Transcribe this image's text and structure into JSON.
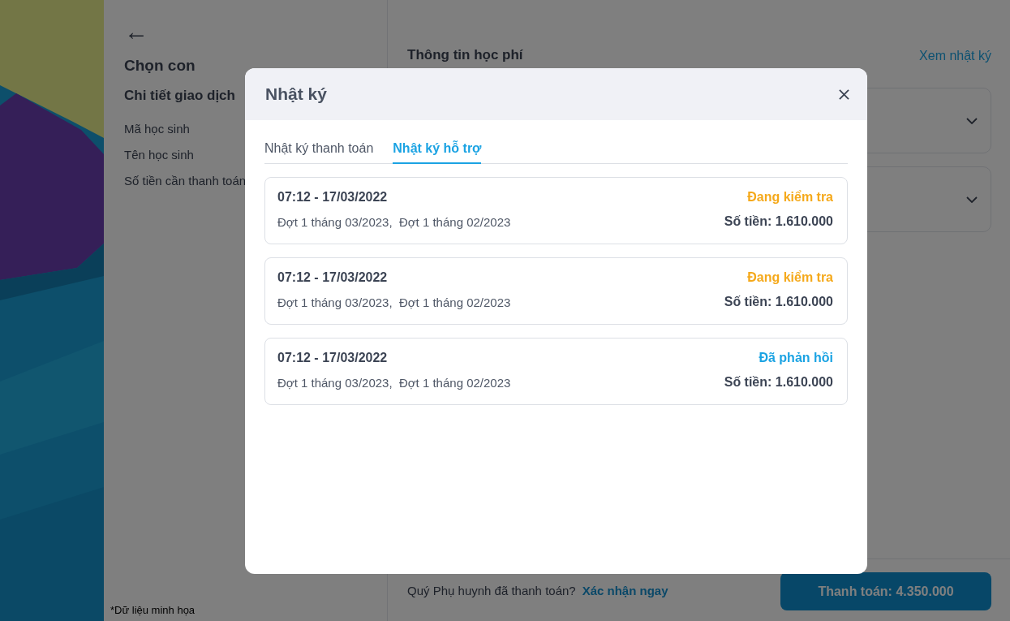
{
  "sidebar": {
    "back": "←",
    "title": "Chọn con",
    "section": "Chi tiết giao dịch",
    "fields": [
      "Mã học sinh",
      "Tên học sinh",
      "Số tiền cần thanh toán"
    ],
    "footnote": "*Dữ liệu minh họa"
  },
  "main": {
    "heading": "Thông tin học phí",
    "log_link": "Xem nhật ký",
    "panels": [
      {
        "expanded": false
      },
      {
        "expanded": false
      }
    ]
  },
  "footer": {
    "question": "Quý Phụ huynh đã thanh toán?",
    "confirm_link": "Xác nhận ngay",
    "pay_button": "Thanh toán: 4.350.000"
  },
  "dialog": {
    "title": "Nhật ký",
    "tabs": [
      {
        "label": "Nhật ký thanh toán",
        "selected": false
      },
      {
        "label": "Nhật ký hỗ trợ",
        "selected": true
      }
    ],
    "entries": [
      {
        "time": "07:12 - 17/03/2022",
        "periods": "Đợt 1 tháng 03/2023,  Đợt 1 tháng 02/2023",
        "status": "Đang kiểm tra",
        "color": "#f5a91b",
        "amount": "Số tiền: 1.610.000"
      },
      {
        "time": "07:12 - 17/03/2022",
        "periods": "Đợt 1 tháng 03/2023,  Đợt 1 tháng 02/2023",
        "status": "Đang kiểm tra",
        "color": "#f5a91b",
        "amount": "Số tiền: 1.610.000"
      },
      {
        "time": "07:12 - 17/03/2022",
        "periods": "Đợt 1 tháng 03/2023,  Đợt 1 tháng 02/2023",
        "status": "Đã phản hồi",
        "color": "#1ba3e3",
        "amount": "Số tiền: 1.610.000"
      }
    ]
  }
}
